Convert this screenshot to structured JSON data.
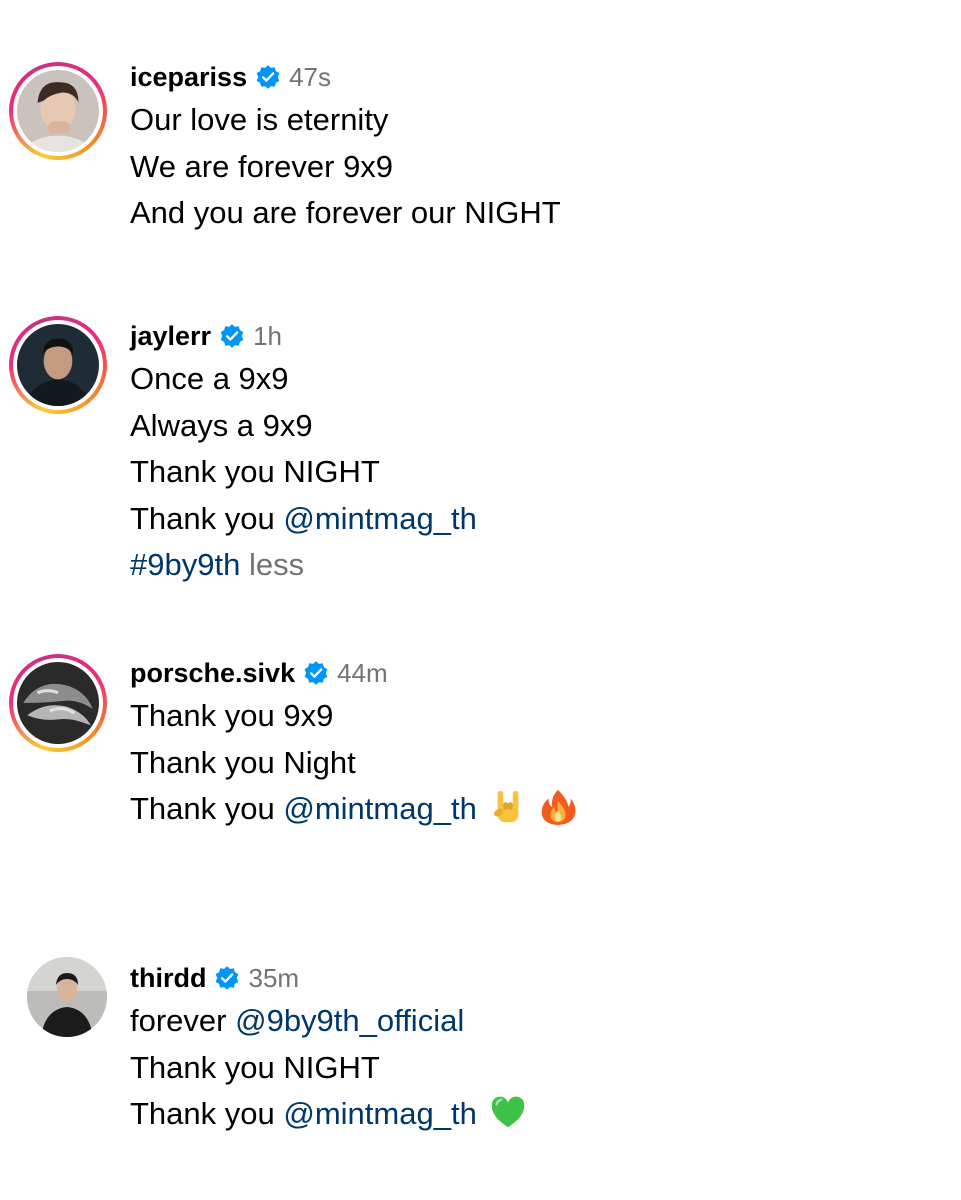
{
  "comments": [
    {
      "username": "icepariss",
      "time": "47s",
      "lines": [
        "Our love is eternity",
        "We are forever 9x9",
        "And you are forever our NIGHT"
      ]
    },
    {
      "username": "jaylerr",
      "time": "1h",
      "lines": [
        "Once a 9x9",
        "Always a 9x9",
        "Thank you NIGHT"
      ],
      "line4_prefix": "Thank you ",
      "line4_mention": "@mintmag_th",
      "hashtag": "#9by9th",
      "less_label": "less"
    },
    {
      "username": "porsche.sivk",
      "time": "44m",
      "lines": [
        "Thank you 9x9",
        "Thank you Night"
      ],
      "line3_prefix": "Thank you ",
      "line3_mention": "@mintmag_th",
      "emojis": [
        "rock-hand-emoji",
        "fire-emoji"
      ]
    },
    {
      "username": "thirdd",
      "time": "35m",
      "line1_prefix": "forever ",
      "line1_mention": "@9by9th_official",
      "line2": "Thank you NIGHT",
      "line3_prefix": "Thank you ",
      "line3_mention": "@mintmag_th",
      "emojis": [
        "green-heart-emoji"
      ]
    }
  ],
  "colors": {
    "mention": "#00376b",
    "secondary_text": "#737373",
    "verified_badge": "#0095f6",
    "story_ring_start": "#f9ce34",
    "story_ring_mid": "#ee2a7b"
  }
}
